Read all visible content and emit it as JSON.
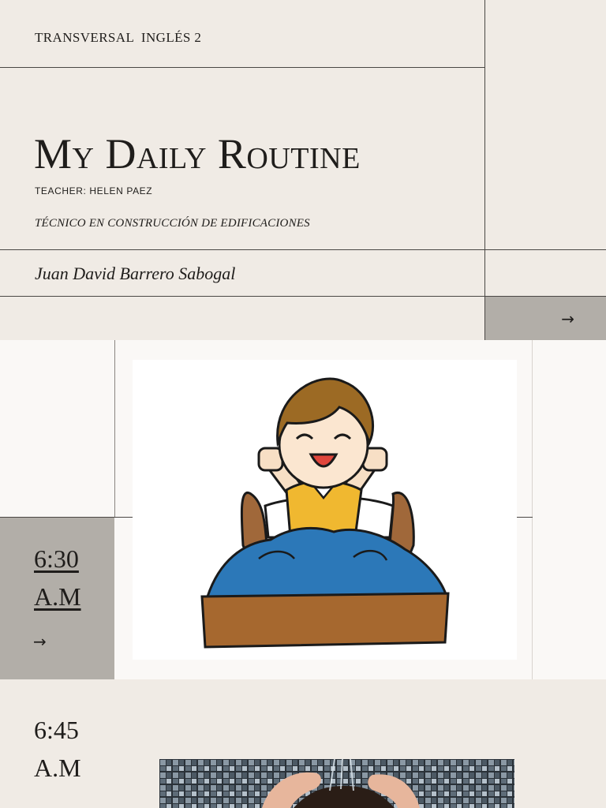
{
  "cover": {
    "course": "TRANSVERSAL  INGLÉS 2",
    "title": "My Daily Routine",
    "teacher": "TEACHER: HELEN PAEZ",
    "program": "TÉCNICO EN CONSTRUCCIÓN DE EDIFICACIONES",
    "author": "Juan David Barrero Sabogal",
    "next_arrow": "→"
  },
  "routine": [
    {
      "time_line1": "6:30",
      "time_line2": "A.M",
      "arrow": "→",
      "illustration": "boy-waking-up-in-bed"
    },
    {
      "time_line1": "6:45",
      "time_line2": "A.M",
      "illustration": "hair-washing-shower-photo"
    }
  ],
  "colors": {
    "background": "#f0ebe5",
    "section_light": "#faf8f6",
    "panel_gray": "#b2aea8",
    "text": "#1f1d1b",
    "rule": "#4a4744"
  }
}
